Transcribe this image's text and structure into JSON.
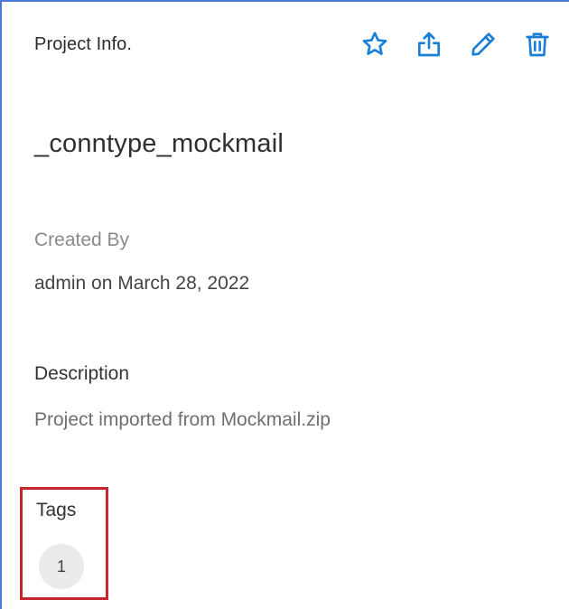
{
  "header": {
    "title": "Project Info.",
    "actions": [
      {
        "name": "favorite",
        "icon": "star-icon"
      },
      {
        "name": "export",
        "icon": "upload-icon"
      },
      {
        "name": "edit",
        "icon": "pencil-icon"
      },
      {
        "name": "delete",
        "icon": "trash-icon"
      }
    ]
  },
  "project": {
    "name": "_conntype_mockmail",
    "created_by_label": "Created By",
    "created_by_value": "admin on March 28, 2022",
    "description_label": "Description",
    "description_value": "Project imported from Mockmail.zip",
    "tags_label": "Tags",
    "tags": [
      "1"
    ]
  },
  "colors": {
    "accent": "#1a7fd6",
    "highlight_border": "#c8262f",
    "panel_border": "#4a78d4"
  }
}
